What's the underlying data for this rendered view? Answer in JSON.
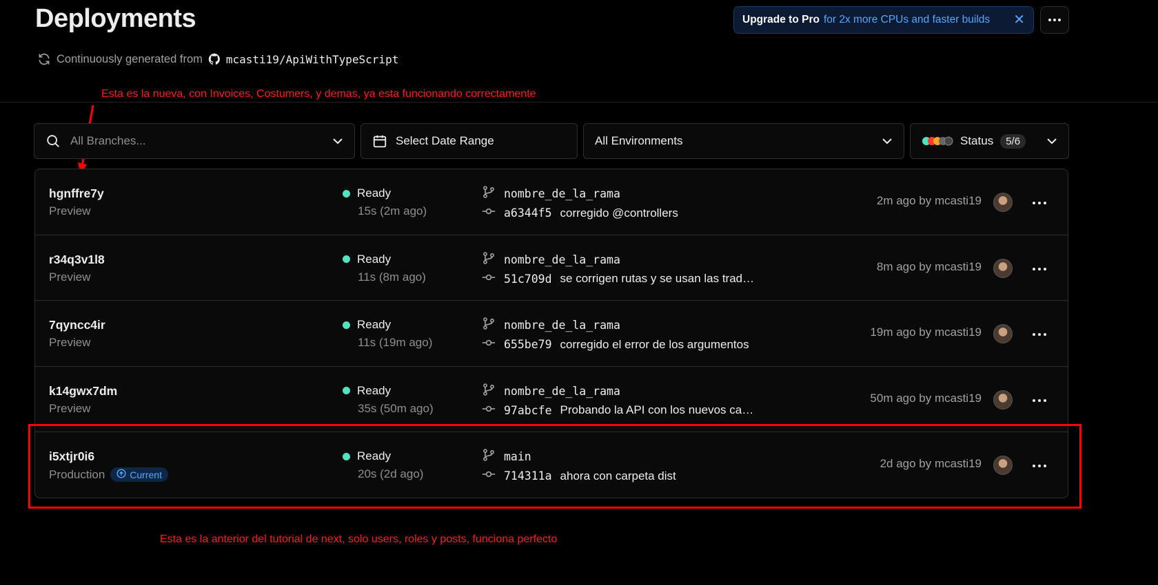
{
  "header": {
    "title": "Deployments",
    "generated_label": "Continuously generated from",
    "repo": "mcasti19/ApiWithTypeScript"
  },
  "banner": {
    "strong": "Upgrade to Pro",
    "text": "for 2x more CPUs and faster builds"
  },
  "filters": {
    "branches_placeholder": "All Branches...",
    "date_label": "Select Date Range",
    "env_label": "All Environments",
    "status_label": "Status",
    "status_count": "5/6"
  },
  "annotations": {
    "top": "Esta es la nueva, con Invoices, Costumers, y demas, ya esta funcionando correctamente",
    "bottom": "Esta es la anterior del tutorial de next, solo users, roles y posts, funciona perfecto"
  },
  "deployments": [
    {
      "id": "hgnffre7y",
      "env": "Preview",
      "status": "Ready",
      "duration": "15s (2m ago)",
      "branch": "nombre_de_la_rama",
      "hash": "a6344f5",
      "message": "corregido @controllers",
      "time": "2m ago by mcasti19"
    },
    {
      "id": "r34q3v1l8",
      "env": "Preview",
      "status": "Ready",
      "duration": "11s (8m ago)",
      "branch": "nombre_de_la_rama",
      "hash": "51c709d",
      "message": "se corrigen rutas y se usan las traducciones",
      "time": "8m ago by mcasti19"
    },
    {
      "id": "7qyncc4ir",
      "env": "Preview",
      "status": "Ready",
      "duration": "11s (19m ago)",
      "branch": "nombre_de_la_rama",
      "hash": "655be79",
      "message": "corregido el error de los argumentos",
      "time": "19m ago by mcasti19"
    },
    {
      "id": "k14gwx7dm",
      "env": "Preview",
      "status": "Ready",
      "duration": "35s (50m ago)",
      "branch": "nombre_de_la_rama",
      "hash": "97abcfe",
      "message": "Probando la API con los nuevos cambios",
      "time": "50m ago by mcasti19"
    },
    {
      "id": "i5xtjr0i6",
      "env": "Production",
      "badge": "Current",
      "status": "Ready",
      "duration": "20s (2d ago)",
      "branch": "main",
      "hash": "714311a",
      "message": "ahora con carpeta dist",
      "time": "2d ago by mcasti19"
    }
  ],
  "colors": {
    "ready": "#50e3c2",
    "annotation": "#ff0000",
    "link": "#52a8ff"
  }
}
